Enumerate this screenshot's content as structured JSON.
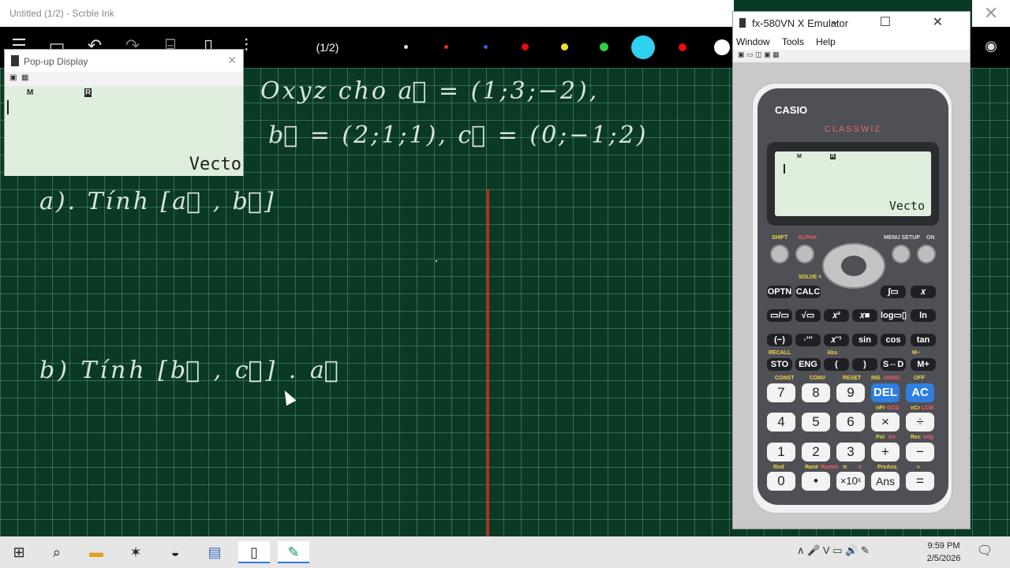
{
  "scrble": {
    "title": "Untitled (1/2) - Scrble Ink",
    "close_glyph": "✕",
    "page_indicator": "(1/2)",
    "toolbar_icons": [
      "menu-icon",
      "save-icon",
      "undo-icon",
      "redo-icon",
      "clipboard-icon",
      "new-page-icon",
      "settings-sliders-icon"
    ],
    "eye_icon": "eye-icon",
    "colors": [
      "#dddddd",
      "#e03030",
      "#3a5fd9",
      "#e01010",
      "#f0e020",
      "#30d040",
      "#30d0f0",
      "#e01010",
      "#ffffff"
    ],
    "selected_color": "#30d0f0"
  },
  "board": {
    "line1": "Oxyz cho a⃗ = (1;3;−2),",
    "line2": "b⃗ = (2;1;1), c⃗ = (0;−1;2)",
    "line3": "a). Tính [a⃗ , b⃗]",
    "line4": "b) Tính [b⃗ , c⃗] . a⃗"
  },
  "popup": {
    "title": "Pop-up Display",
    "close_glyph": "✕",
    "indicator_m": "M",
    "indicator_r": "R",
    "mode_text": "Vecto"
  },
  "emulator": {
    "title": "fx-580VN X Emulator",
    "controls": "–  ☐  ✕",
    "menu": [
      "Window",
      "Tools",
      "Help"
    ],
    "calc": {
      "brand": "CASIO",
      "model": "CLASSWIZ",
      "lcd_indicator_m": "M",
      "lcd_indicator_r": "R",
      "lcd_mode": "Vecto",
      "top_labels": {
        "shift": "SHIFT",
        "alpha": "ALPHA",
        "menu": "MENU SETUP",
        "on": "ON",
        "solve": "SOLVE ="
      },
      "func_rows": [
        [
          "OPTN",
          "CALC",
          "∫▭",
          "𝑥"
        ],
        [
          "▭/▭",
          "√▭",
          "𝑥²",
          "𝑥■",
          "log▭▯",
          "ln"
        ],
        [
          "(−)",
          "◦'''",
          "𝑥⁻¹",
          "sin",
          "cos",
          "tan"
        ],
        [
          "STO",
          "ENG",
          "(",
          ")",
          "S⇔D",
          "M+"
        ]
      ],
      "num_rows": [
        [
          "7",
          "8",
          "9",
          "DEL",
          "AC"
        ],
        [
          "4",
          "5",
          "6",
          "×",
          "÷"
        ],
        [
          "1",
          "2",
          "3",
          "+",
          "−"
        ],
        [
          "0",
          "•",
          "×10ˣ",
          "Ans",
          "="
        ]
      ],
      "small_labels": {
        "const": "CONST",
        "conv": "CONV",
        "reset": "RESET",
        "ins": "INS",
        "undo": "UNDO",
        "off": "OFF",
        "recall": "RECALL",
        "abs": "Abs",
        "mminus": "M−",
        "npr": "nPr",
        "gcd": "GCD",
        "ncr": "nCr",
        "lcm": "LCM",
        "pol": "Pol",
        "int": "Int",
        "rec": "Rec",
        "intg": "Intg",
        "rnd": "Rnd",
        "ran": "Ran#",
        "ranint": "RanInt",
        "pi": "π",
        "e": "e",
        "preans": "PreAns",
        "approx": "≈"
      }
    }
  },
  "taskbar": {
    "icons": [
      "windows-start-icon",
      "search-icon",
      "file-explorer-icon",
      "sun-app-icon",
      "drawing-app-icon",
      "network-app-icon",
      "calculator-icon",
      "scrble-icon"
    ],
    "tray_glyphs": "∧  🎤  V  ▭  🔊  ✎",
    "time": "9:59 PM",
    "date": "2/5/2026",
    "notification_glyph": "🗨"
  }
}
